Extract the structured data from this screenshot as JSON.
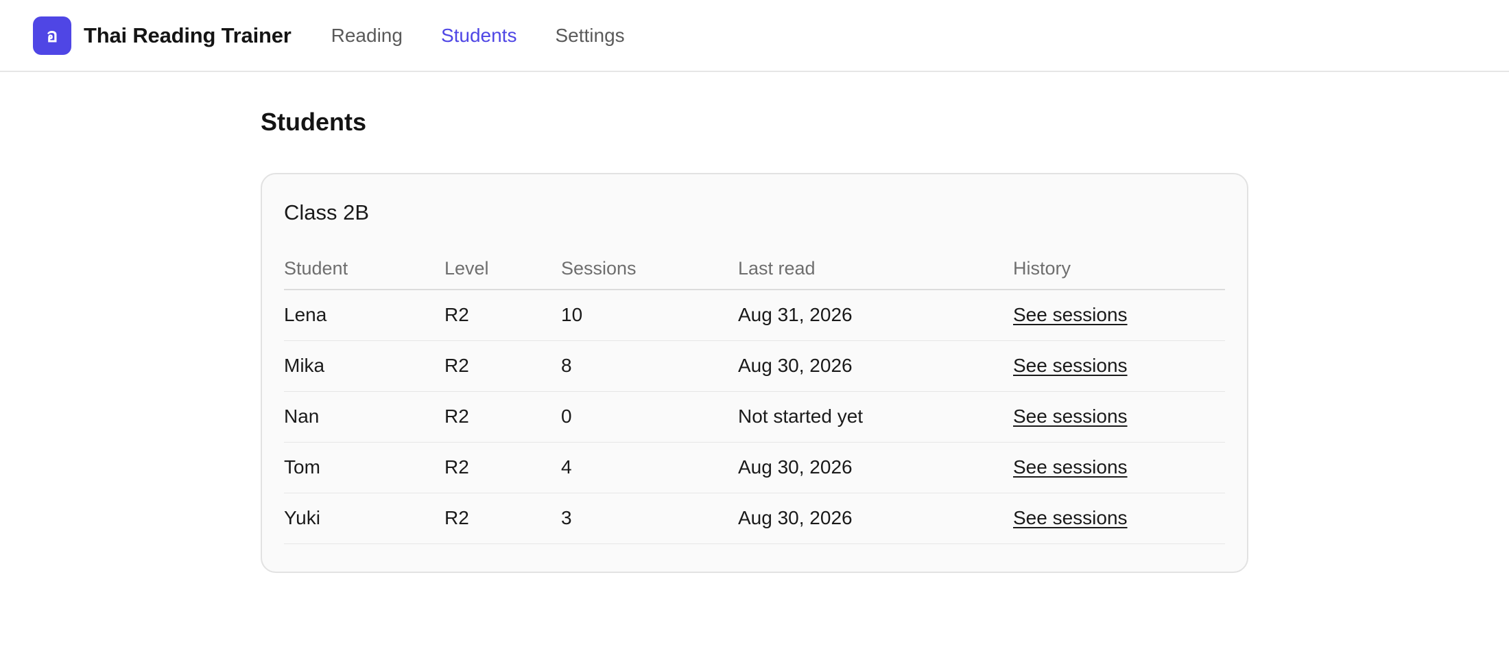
{
  "app": {
    "logo_glyph": "อ",
    "title": "Thai Reading Trainer",
    "accent_color": "#4f46e5"
  },
  "nav": {
    "items": [
      {
        "label": "Reading",
        "active": false
      },
      {
        "label": "Students",
        "active": true
      },
      {
        "label": "Settings",
        "active": false
      }
    ]
  },
  "page": {
    "title": "Students"
  },
  "class_card": {
    "name": "Class 2B",
    "columns": [
      "Student",
      "Level",
      "Sessions",
      "Last read",
      "History"
    ],
    "rows": [
      {
        "student": "Lena",
        "level": "R2",
        "sessions": "10",
        "last_read": "Aug 31, 2026",
        "history": "See sessions"
      },
      {
        "student": "Mika",
        "level": "R2",
        "sessions": "8",
        "last_read": "Aug 30, 2026",
        "history": "See sessions"
      },
      {
        "student": "Nan",
        "level": "R2",
        "sessions": "0",
        "last_read": "Not started yet",
        "history": "See sessions"
      },
      {
        "student": "Tom",
        "level": "R2",
        "sessions": "4",
        "last_read": "Aug 30, 2026",
        "history": "See sessions"
      },
      {
        "student": "Yuki",
        "level": "R2",
        "sessions": "3",
        "last_read": "Aug 30, 2026",
        "history": "See sessions"
      }
    ]
  }
}
